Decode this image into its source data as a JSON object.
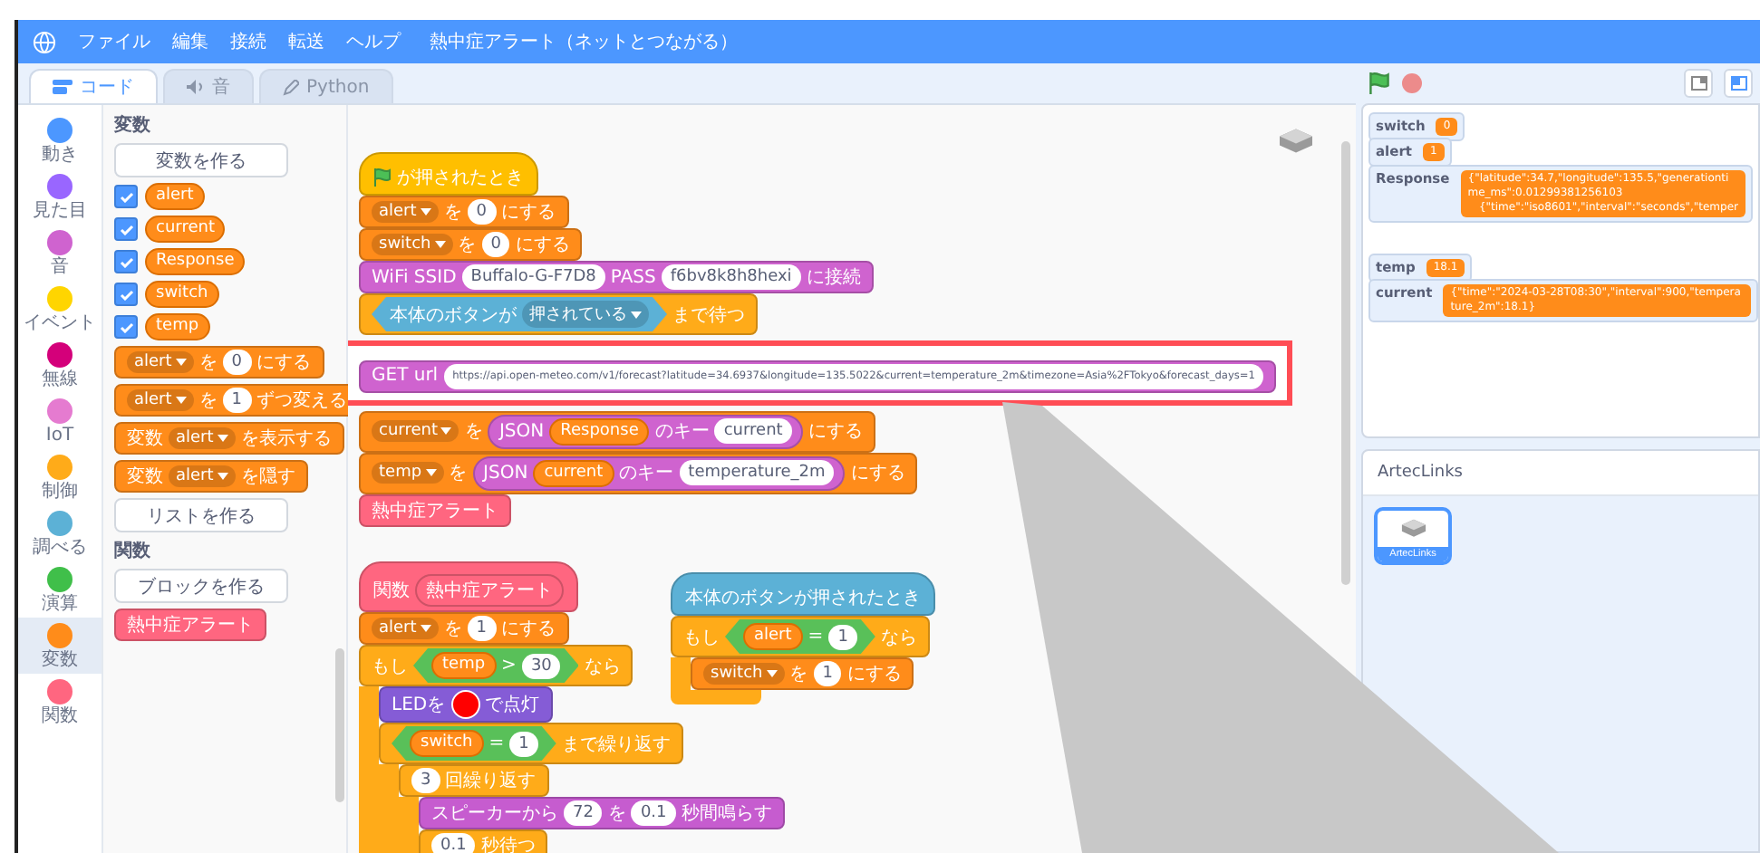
{
  "menu_bar": {
    "items": [
      "ファイル",
      "編集",
      "接続",
      "転送",
      "ヘルプ"
    ],
    "project_title": "熱中症アラート（ネットとつながる）"
  },
  "editor_tabs": [
    {
      "label": "コード",
      "kind": "code",
      "selected": true
    },
    {
      "label": "音",
      "kind": "sound",
      "selected": false
    },
    {
      "label": "Python",
      "kind": "python",
      "selected": false
    }
  ],
  "categories": [
    {
      "label": "動き",
      "color": "#4c97ff",
      "selected": false
    },
    {
      "label": "見た目",
      "color": "#9966ff",
      "selected": false
    },
    {
      "label": "音",
      "color": "#cf63cf",
      "selected": false
    },
    {
      "label": "イベント",
      "color": "#ffd500",
      "selected": false
    },
    {
      "label": "無線",
      "color": "#d4007a",
      "selected": false
    },
    {
      "label": "IoT",
      "color": "#e57bd0",
      "selected": false
    },
    {
      "label": "制御",
      "color": "#ffab19",
      "selected": false
    },
    {
      "label": "調べる",
      "color": "#5cb1d6",
      "selected": false
    },
    {
      "label": "演算",
      "color": "#40bf4a",
      "selected": false
    },
    {
      "label": "変数",
      "color": "#ff8c1a",
      "selected": true
    },
    {
      "label": "関数",
      "color": "#ff6680",
      "selected": false
    }
  ],
  "palette": {
    "variables_heading": "変数",
    "make_variable": "変数を作る",
    "variables": [
      {
        "name": "alert",
        "checked": true
      },
      {
        "name": "current",
        "checked": true
      },
      {
        "name": "Response",
        "checked": true
      },
      {
        "name": "switch",
        "checked": true
      },
      {
        "name": "temp",
        "checked": true
      }
    ],
    "blocks": [
      {
        "color": "#ff8c1a",
        "kind": "stack",
        "parts": [
          {
            "kind": "menu",
            "text": "alert"
          },
          {
            "kind": "text",
            "text": "を"
          },
          {
            "kind": "field",
            "text": "0"
          },
          {
            "kind": "text",
            "text": "にする"
          }
        ]
      },
      {
        "color": "#ff8c1a",
        "kind": "stack",
        "parts": [
          {
            "kind": "menu",
            "text": "alert"
          },
          {
            "kind": "text",
            "text": "を"
          },
          {
            "kind": "field",
            "text": "1"
          },
          {
            "kind": "text",
            "text": "ずつ変える"
          }
        ]
      },
      {
        "color": "#ff8c1a",
        "kind": "stack",
        "parts": [
          {
            "kind": "text",
            "text": "変数"
          },
          {
            "kind": "menu",
            "text": "alert"
          },
          {
            "kind": "text",
            "text": "を表示する"
          }
        ]
      },
      {
        "color": "#ff8c1a",
        "kind": "stack",
        "parts": [
          {
            "kind": "text",
            "text": "変数"
          },
          {
            "kind": "menu",
            "text": "alert"
          },
          {
            "kind": "text",
            "text": "を隠す"
          }
        ]
      }
    ],
    "make_list": "リストを作る",
    "functions_heading": "関数",
    "make_block": "ブロックを作る",
    "function_blocks": [
      {
        "color": "#ff6680",
        "kind": "stack",
        "parts": [
          {
            "kind": "text",
            "text": "熱中症アラート"
          }
        ]
      }
    ]
  },
  "scripts": [
    {
      "blocks": [
        {
          "color": "#ffbf00",
          "kind": "hat",
          "highlighted": false,
          "parts": [
            {
              "kind": "flag"
            },
            {
              "kind": "text",
              "text": "が押されたとき"
            }
          ]
        },
        {
          "color": "#ff8c1a",
          "kind": "stack",
          "highlighted": false,
          "parts": [
            {
              "kind": "menu",
              "text": "alert"
            },
            {
              "kind": "text",
              "text": "を"
            },
            {
              "kind": "field",
              "text": "0"
            },
            {
              "kind": "text",
              "text": "にする"
            }
          ]
        },
        {
          "color": "#ff8c1a",
          "kind": "stack",
          "highlighted": false,
          "parts": [
            {
              "kind": "menu",
              "text": "switch"
            },
            {
              "kind": "text",
              "text": "を"
            },
            {
              "kind": "field",
              "text": "0"
            },
            {
              "kind": "text",
              "text": "にする"
            }
          ]
        },
        {
          "color": "#cf63cf",
          "kind": "stack",
          "highlighted": false,
          "parts": [
            {
              "kind": "text",
              "text": "WiFi SSID"
            },
            {
              "kind": "field",
              "text": "Buffalo-G-F7D8"
            },
            {
              "kind": "text",
              "text": "PASS"
            },
            {
              "kind": "field",
              "text": "f6bv8k8h8hexi"
            },
            {
              "kind": "text",
              "text": "に接続"
            }
          ]
        },
        {
          "color": "#ffab19",
          "kind": "stack",
          "highlighted": false,
          "parts": [
            {
              "kind": "bool",
              "color": "#5cb1d6",
              "parts": [
                {
                  "kind": "text",
                  "text": "本体のボタンが"
                },
                {
                  "kind": "menu",
                  "text": "押されている"
                }
              ]
            },
            {
              "kind": "text",
              "text": "まで待つ"
            }
          ]
        },
        {
          "color": "#cf63cf",
          "kind": "stack",
          "highlighted": true,
          "parts": [
            {
              "kind": "text",
              "text": "GET url"
            },
            {
              "kind": "url",
              "text": "https://api.open-meteo.com/v1/forecast?latitude=34.6937&longitude=135.5022&current=temperature_2m&timezone=Asia%2FTokyo&forecast_days=1"
            }
          ]
        },
        {
          "color": "#ff8c1a",
          "kind": "stack",
          "highlighted": false,
          "parts": [
            {
              "kind": "menu",
              "text": "current"
            },
            {
              "kind": "text",
              "text": "を"
            },
            {
              "kind": "reporter",
              "color": "#cf63cf",
              "parts": [
                {
                  "kind": "text",
                  "text": "JSON"
                },
                {
                  "kind": "var",
                  "text": "Response"
                },
                {
                  "kind": "text",
                  "text": "のキー"
                },
                {
                  "kind": "field",
                  "text": "current"
                }
              ]
            },
            {
              "kind": "text",
              "text": "にする"
            }
          ]
        },
        {
          "color": "#ff8c1a",
          "kind": "stack",
          "highlighted": false,
          "parts": [
            {
              "kind": "menu",
              "text": "temp"
            },
            {
              "kind": "text",
              "text": "を"
            },
            {
              "kind": "reporter",
              "color": "#cf63cf",
              "parts": [
                {
                  "kind": "text",
                  "text": "JSON"
                },
                {
                  "kind": "var",
                  "text": "current"
                },
                {
                  "kind": "text",
                  "text": "のキー"
                },
                {
                  "kind": "field",
                  "text": "temperature_2m"
                }
              ]
            },
            {
              "kind": "text",
              "text": "にする"
            }
          ]
        },
        {
          "color": "#ff6680",
          "kind": "stack",
          "highlighted": false,
          "parts": [
            {
              "kind": "text",
              "text": "熱中症アラート"
            }
          ]
        }
      ]
    },
    {
      "blocks": [
        {
          "color": "#ff6680",
          "kind": "define",
          "parts": [
            {
              "kind": "text",
              "text": "関数"
            },
            {
              "kind": "reporter",
              "color": "#ff6680",
              "parts": [
                {
                  "kind": "text",
                  "text": "熱中症アラート"
                }
              ]
            }
          ]
        },
        {
          "color": "#ff8c1a",
          "kind": "stack",
          "parts": [
            {
              "kind": "menu",
              "text": "alert"
            },
            {
              "kind": "text",
              "text": "を"
            },
            {
              "kind": "field",
              "text": "1"
            },
            {
              "kind": "text",
              "text": "にする"
            }
          ]
        },
        {
          "color": "#ffab19",
          "kind": "c",
          "parts": [
            {
              "kind": "text",
              "text": "もし"
            },
            {
              "kind": "bool",
              "color": "#59c059",
              "parts": [
                {
                  "kind": "var",
                  "text": "temp"
                },
                {
                  "kind": "text",
                  "text": ">"
                },
                {
                  "kind": "field",
                  "text": "30"
                }
              ]
            },
            {
              "kind": "text",
              "text": "なら"
            }
          ],
          "children": [
            {
              "color": "#855cd6",
              "kind": "stack",
              "parts": [
                {
                  "kind": "text",
                  "text": "LEDを"
                },
                {
                  "kind": "swatch",
                  "color": "#ff0000"
                },
                {
                  "kind": "text",
                  "text": "で点灯"
                }
              ]
            },
            {
              "color": "#ffab19",
              "kind": "c",
              "parts": [
                {
                  "kind": "bool",
                  "color": "#59c059",
                  "parts": [
                    {
                      "kind": "var",
                      "text": "switch"
                    },
                    {
                      "kind": "text",
                      "text": "="
                    },
                    {
                      "kind": "field",
                      "text": "1"
                    }
                  ]
                },
                {
                  "kind": "text",
                  "text": "まで繰り返す"
                }
              ],
              "children": [
                {
                  "color": "#ffab19",
                  "kind": "c",
                  "parts": [
                    {
                      "kind": "field",
                      "text": "3"
                    },
                    {
                      "kind": "text",
                      "text": "回繰り返す"
                    }
                  ],
                  "children": [
                    {
                      "color": "#c65ccf",
                      "kind": "stack",
                      "parts": [
                        {
                          "kind": "text",
                          "text": "スピーカーから"
                        },
                        {
                          "kind": "field",
                          "text": "72"
                        },
                        {
                          "kind": "text",
                          "text": "を"
                        },
                        {
                          "kind": "field",
                          "text": "0.1"
                        },
                        {
                          "kind": "text",
                          "text": "秒間鳴らす"
                        }
                      ]
                    },
                    {
                      "color": "#ffab19",
                      "kind": "stack",
                      "parts": [
                        {
                          "kind": "field",
                          "text": "0.1"
                        },
                        {
                          "kind": "text",
                          "text": "秒待つ"
                        }
                      ]
                    }
                  ]
                }
              ]
            }
          ]
        }
      ]
    },
    {
      "blocks": [
        {
          "color": "#5cb1d6",
          "kind": "hat",
          "parts": [
            {
              "kind": "text",
              "text": "本体のボタンが押されたとき"
            }
          ]
        },
        {
          "color": "#ffab19",
          "kind": "c",
          "parts": [
            {
              "kind": "text",
              "text": "もし"
            },
            {
              "kind": "bool",
              "color": "#59c059",
              "parts": [
                {
                  "kind": "var",
                  "text": "alert"
                },
                {
                  "kind": "text",
                  "text": "="
                },
                {
                  "kind": "field",
                  "text": "1"
                }
              ]
            },
            {
              "kind": "text",
              "text": "なら"
            }
          ],
          "children": [
            {
              "color": "#ff8c1a",
              "kind": "stack",
              "parts": [
                {
                  "kind": "menu",
                  "text": "switch"
                },
                {
                  "kind": "text",
                  "text": "を"
                },
                {
                  "kind": "field",
                  "text": "1"
                },
                {
                  "kind": "text",
                  "text": "にする"
                }
              ]
            }
          ]
        }
      ]
    }
  ],
  "stage": {
    "monitors": [
      {
        "label": "switch",
        "kind": "small",
        "lines": [
          "0"
        ]
      },
      {
        "label": "alert",
        "kind": "small",
        "lines": [
          "1"
        ]
      },
      {
        "label": "Response",
        "kind": "large",
        "lines": [
          "{\"latitude\":34.7,\"longitude\":135.5,\"generationtime_ms\":0.01299381256103",
          "{\"time\":\"iso8601\",\"interval\":\"seconds\",\"temper"
        ]
      },
      {
        "label": "temp",
        "kind": "small",
        "lines": [
          "18.1"
        ]
      },
      {
        "label": "current",
        "kind": "small",
        "lines": [
          "{\"time\":\"2024-03-28T08:30\",\"interval\":900,\"temperature_2m\":18.1}"
        ]
      }
    ]
  },
  "sprite_pane": {
    "title": "ArtecLinks",
    "sprites": [
      {
        "name": "ArtecLinks",
        "selected": true
      }
    ]
  }
}
